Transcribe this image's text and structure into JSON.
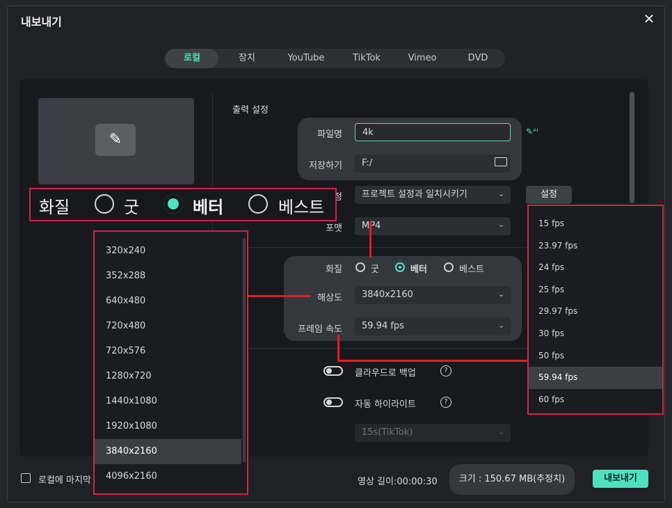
{
  "dialog": {
    "title": "내보내기",
    "close": "✕"
  },
  "tabs": [
    "로컬",
    "장치",
    "YouTube",
    "TikTok",
    "Vimeo",
    "DVD"
  ],
  "output": {
    "section_title": "출력 설정",
    "filename_label": "파일명",
    "filename_value": "4k",
    "save_label": "저장하기",
    "save_value": "F:/",
    "preset_label_partial": "정",
    "preset_value": "프로젝트 설정과 일치시키기",
    "settings_button": "설정",
    "format_label": "포맷",
    "format_value": "MP4",
    "quality_label": "화질",
    "quality_options": [
      "굿",
      "베터",
      "베스트"
    ],
    "resolution_label": "해상도",
    "resolution_value": "3840x2160",
    "framerate_label": "프레임 속도",
    "framerate_value": "59.94 fps",
    "cloud_backup": "클라우드로 백업",
    "auto_highlight": "자동 하이라이트",
    "help": "?",
    "tiktok_value": "15s(TikTok)"
  },
  "zoom_quality": {
    "label": "화질",
    "options": [
      "굿",
      "베터",
      "베스트"
    ]
  },
  "resolution_menu": [
    "320x240",
    "352x288",
    "640x480",
    "720x480",
    "720x576",
    "1280x720",
    "1440x1080",
    "1920x1080",
    "3840x2160",
    "4096x2160"
  ],
  "framerate_menu": [
    "15 fps",
    "23.97 fps",
    "24 fps",
    "25 fps",
    "29.97 fps",
    "30 fps",
    "50 fps",
    "59.94 fps",
    "60 fps"
  ],
  "footer": {
    "checkbox_label": "로컬에 마지막",
    "duration": "영상 길이:00:00:30",
    "size": "크기 : 150.67 MB(추정치)",
    "export": "내보내기"
  },
  "colors": {
    "accent": "#4fe0c0",
    "highlight_red": "#e21b2a"
  }
}
